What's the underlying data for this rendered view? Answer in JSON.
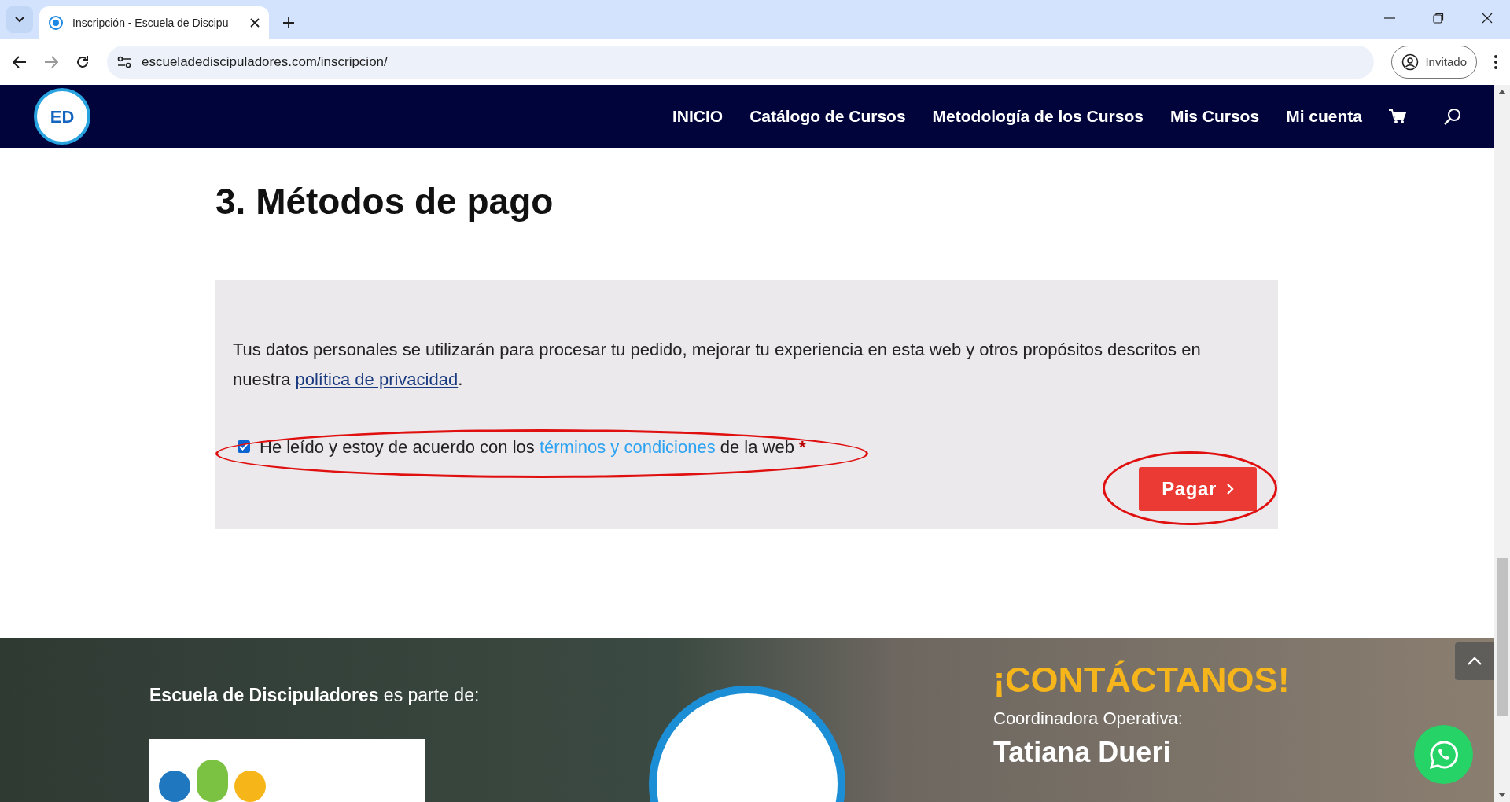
{
  "browser": {
    "tab_title": "Inscripción - Escuela de Discipu",
    "url": "escueladediscipuladores.com/inscripcion/",
    "profile": "Invitado"
  },
  "site_nav": {
    "logo_text": "ED",
    "items": [
      "INICIO",
      "Catálogo de Cursos",
      "Metodología de los Cursos",
      "Mis Cursos",
      "Mi cuenta"
    ]
  },
  "section_title": "3. Métodos de pago",
  "privacy_text": "Tus datos personales se utilizarán para procesar tu pedido, mejorar tu experiencia en esta web y otros propósitos descritos en nuestra",
  "privacy_link": "política de privacidad",
  "privacy_end": ".",
  "terms": {
    "checked": true,
    "before": "He leído y estoy de acuerdo con los",
    "link": "términos y condiciones",
    "after": "de la web",
    "required": "*"
  },
  "pay_button": "Pagar",
  "footer": {
    "part_of_bold": "Escuela de Discipuladores",
    "part_of_rest": "es parte de:",
    "contact_title": "¡CONTÁCTANOS!",
    "coordinator_label": "Coordinadora Operativa:",
    "coordinator_name": "Tatiana Dueri"
  }
}
